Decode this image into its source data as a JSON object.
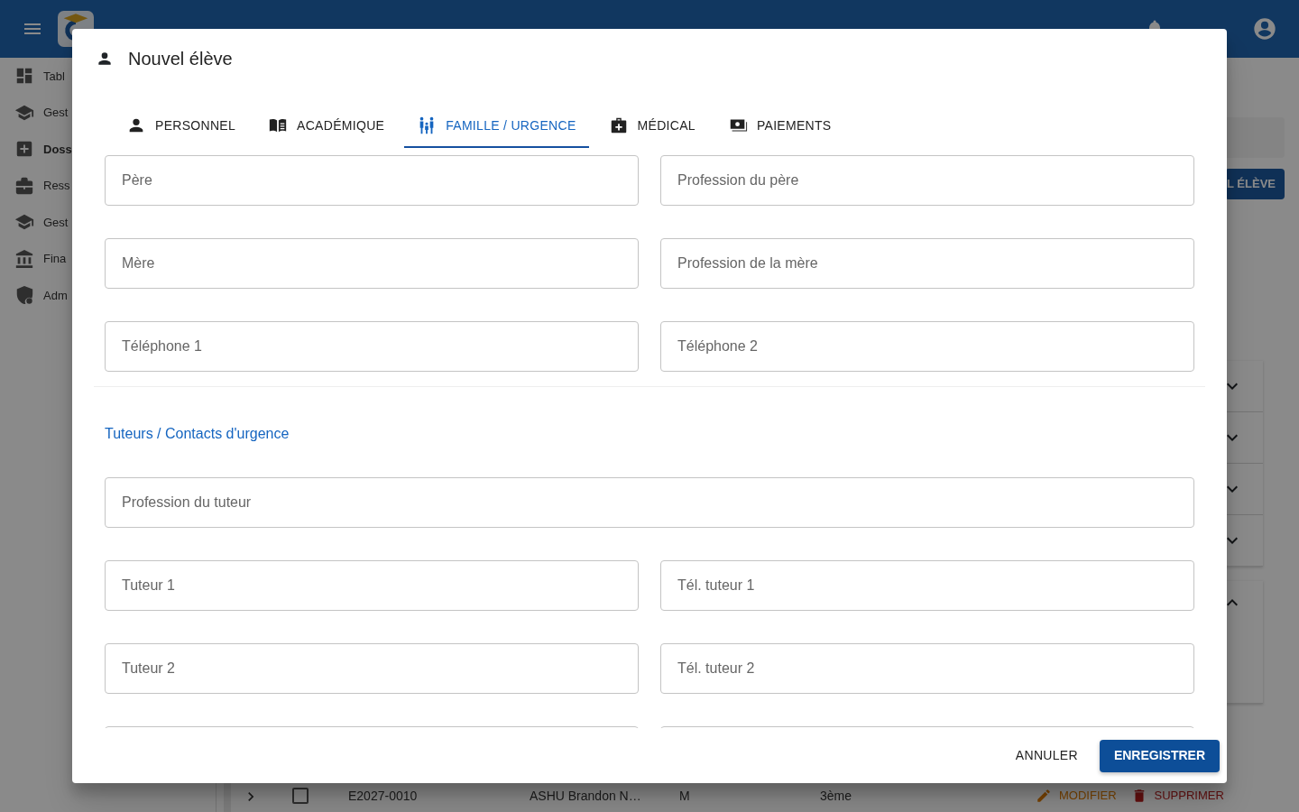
{
  "sidebar": {
    "items": [
      {
        "label": "Tabl",
        "selected": false
      },
      {
        "label": "Gest",
        "selected": false
      },
      {
        "label": "Doss",
        "selected": true
      },
      {
        "label": "Ress",
        "selected": false
      },
      {
        "label": "Gest",
        "selected": false
      },
      {
        "label": "Fina",
        "selected": false
      },
      {
        "label": "Adm",
        "selected": false
      }
    ]
  },
  "background": {
    "add_button": "L ÉLÈVE",
    "accordions": [
      {
        "expanded": false
      },
      {
        "expanded": false
      },
      {
        "expanded": false
      },
      {
        "expanded": false
      },
      {
        "expanded": true
      }
    ],
    "table_row": {
      "checked": false,
      "cells": [
        "E2027-0010",
        "ASHU Brandon N…",
        "M",
        "3ème"
      ],
      "actions": [
        {
          "label": "MODIFIER",
          "kind": "edit"
        },
        {
          "label": "SUPPRIMER",
          "kind": "delete"
        }
      ]
    }
  },
  "dialog": {
    "title": "Nouvel élève",
    "tabs": [
      {
        "label": "PERSONNEL",
        "selected": false
      },
      {
        "label": "ACADÉMIQUE",
        "selected": false
      },
      {
        "label": "FAMILLE / URGENCE",
        "selected": true
      },
      {
        "label": "MÉDICAL",
        "selected": false
      },
      {
        "label": "PAIEMENTS",
        "selected": false
      }
    ],
    "family_fields": [
      [
        {
          "kind": "text",
          "placeholder": "Père"
        },
        {
          "kind": "text",
          "placeholder": "Profession du père"
        }
      ],
      [
        {
          "kind": "text",
          "placeholder": "Mère"
        },
        {
          "kind": "text",
          "placeholder": "Profession de la mère"
        }
      ],
      [
        {
          "kind": "text",
          "placeholder": "Téléphone 1"
        },
        {
          "kind": "text",
          "placeholder": "Téléphone 2"
        }
      ]
    ],
    "section_title": "Tuteurs / Contacts d'urgence",
    "guardian_fields": [
      [
        {
          "kind": "text",
          "placeholder": "Profession du tuteur"
        }
      ],
      [
        {
          "kind": "text",
          "placeholder": "Tuteur 1"
        },
        {
          "kind": "text",
          "placeholder": "Tél. tuteur 1"
        }
      ],
      [
        {
          "kind": "text",
          "placeholder": "Tuteur 2"
        },
        {
          "kind": "text",
          "placeholder": "Tél. tuteur 2"
        }
      ],
      [
        {
          "kind": "text"
        },
        {
          "kind": "text"
        }
      ]
    ],
    "buttons": [
      {
        "label": "ANNULER",
        "kind": "text"
      },
      {
        "label": "ENREGISTRER",
        "kind": "primary"
      }
    ]
  }
}
